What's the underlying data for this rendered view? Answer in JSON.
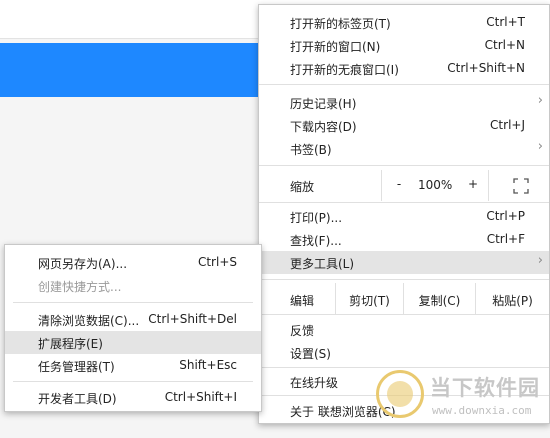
{
  "colors": {
    "accent_blue": "#1e88ff",
    "highlight": "#e4e4e4",
    "disabled_text": "#9a9a9a"
  },
  "main_menu": {
    "new_tab": {
      "label": "打开新的标签页(T)",
      "shortcut": "Ctrl+T"
    },
    "new_window": {
      "label": "打开新的窗口(N)",
      "shortcut": "Ctrl+N"
    },
    "new_incognito": {
      "label": "打开新的无痕窗口(I)",
      "shortcut": "Ctrl+Shift+N"
    },
    "history": {
      "label": "历史记录(H)",
      "arrow": "›"
    },
    "downloads": {
      "label": "下载内容(D)",
      "shortcut": "Ctrl+J"
    },
    "bookmarks": {
      "label": "书签(B)",
      "arrow": "›"
    },
    "zoom": {
      "label": "缩放",
      "minus": "-",
      "value": "100%",
      "plus": "+",
      "fullscreen_icon": "fullscreen-icon"
    },
    "print": {
      "label": "打印(P)...",
      "shortcut": "Ctrl+P"
    },
    "find": {
      "label": "查找(F)...",
      "shortcut": "Ctrl+F"
    },
    "more_tools": {
      "label": "更多工具(L)",
      "arrow": "›"
    },
    "edit": {
      "label": "编辑",
      "cut": "剪切(T)",
      "copy": "复制(C)",
      "paste": "粘贴(P)"
    },
    "feedback": {
      "label": "反馈"
    },
    "settings": {
      "label": "设置(S)"
    },
    "upgrade": {
      "label": "在线升级"
    },
    "about": {
      "label": "关于 联想浏览器(C)"
    }
  },
  "sub_menu": {
    "save_page": {
      "label": "网页另存为(A)...",
      "shortcut": "Ctrl+S"
    },
    "create_shortcut": {
      "label": "创建快捷方式..."
    },
    "clear_data": {
      "label": "清除浏览数据(C)...",
      "shortcut": "Ctrl+Shift+Del"
    },
    "extensions": {
      "label": "扩展程序(E)"
    },
    "task_manager": {
      "label": "任务管理器(T)",
      "shortcut": "Shift+Esc"
    },
    "dev_tools": {
      "label": "开发者工具(D)",
      "shortcut": "Ctrl+Shift+I"
    }
  },
  "watermark": {
    "title": "当下软件园",
    "url": "www.downxia.com"
  }
}
